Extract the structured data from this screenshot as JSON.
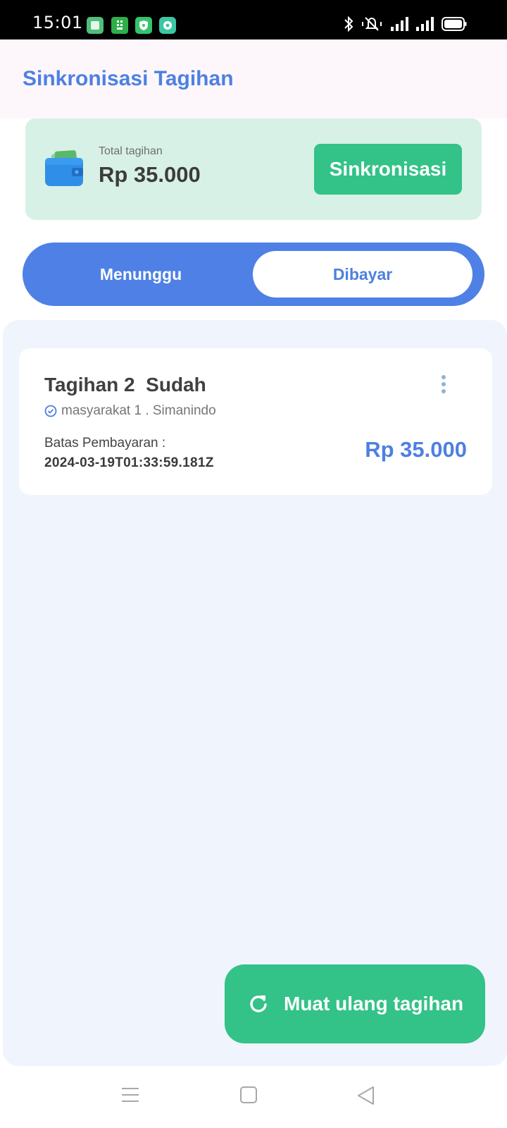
{
  "status_bar": {
    "time": "15:01",
    "app_icons": [
      "app-icon-green-square",
      "app-icon-green-grid",
      "app-icon-shield",
      "app-icon-teal"
    ],
    "right_icons": [
      "bluetooth-icon",
      "vibrate-mute-icon",
      "signal-icon",
      "signal-icon",
      "battery-icon"
    ]
  },
  "app_bar": {
    "title": "Sinkronisasi Tagihan"
  },
  "summary": {
    "label": "Total tagihan",
    "amount": "Rp 35.000",
    "sync_button": "Sinkronisasi",
    "icon": "wallet-icon"
  },
  "tabs": [
    {
      "label": "Menunggu",
      "selected": false
    },
    {
      "label": "Dibayar",
      "selected": true
    }
  ],
  "bills": [
    {
      "title": "Tagihan 2  Sudah",
      "subtitle": "masyarakat 1 . Simanindo",
      "due_label": "Batas Pembayaran :",
      "due_date": "2024-03-19T01:33:59.181Z",
      "amount": "Rp 35.000"
    }
  ],
  "reload_button": {
    "label": "Muat ulang tagihan",
    "icon": "refresh-icon"
  },
  "nav_bar": {
    "icons": [
      "menu-icon",
      "home-icon",
      "back-icon"
    ]
  },
  "colors": {
    "primary_blue": "#4e80e6",
    "green": "#33c287",
    "summary_bg": "#d8f1e6",
    "content_bg": "#f0f4fd"
  }
}
